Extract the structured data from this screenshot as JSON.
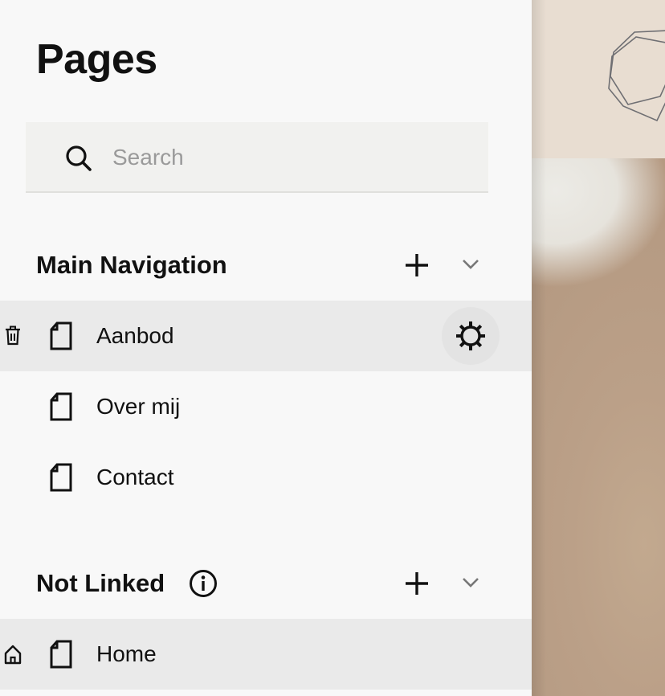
{
  "panel": {
    "title": "Pages",
    "search": {
      "placeholder": "Search",
      "value": ""
    },
    "sections": [
      {
        "title": "Main Navigation",
        "actions": {
          "add_icon": "plus-icon",
          "collapse_icon": "chevron-down-icon"
        },
        "items": [
          {
            "label": "Aanbod",
            "icon": "page-icon",
            "active": true,
            "row_actions": [
              "trash-icon",
              "gear-icon"
            ]
          },
          {
            "label": "Over mij",
            "icon": "page-icon",
            "active": false
          },
          {
            "label": "Contact",
            "icon": "page-icon",
            "active": false
          }
        ]
      },
      {
        "title": "Not Linked",
        "info_icon": "info-icon",
        "actions": {
          "add_icon": "plus-icon",
          "collapse_icon": "chevron-down-icon"
        },
        "items": [
          {
            "label": "Home",
            "icon": "page-icon",
            "active": true,
            "row_actions": [
              "home-icon"
            ]
          }
        ]
      }
    ]
  },
  "colors": {
    "panel_bg": "#f8f8f8",
    "active_row_bg": "#eaeaea",
    "search_bg": "#f1f1ef",
    "text": "#111111",
    "placeholder": "#9a9a9a"
  },
  "preview": {
    "logo_icon": "geometric-polygon-logo"
  }
}
